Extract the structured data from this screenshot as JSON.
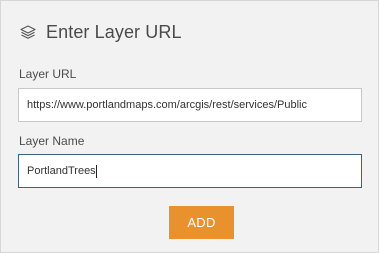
{
  "dialog": {
    "title": "Enter Layer URL",
    "header_icon": "layers-icon"
  },
  "form": {
    "url_label": "Layer URL",
    "url_value": "https://www.portlandmaps.com/arcgis/rest/services/Public",
    "name_label": "Layer Name",
    "name_value": "PortlandTrees"
  },
  "actions": {
    "add_label": "ADD",
    "add_color": "#e8912d"
  }
}
